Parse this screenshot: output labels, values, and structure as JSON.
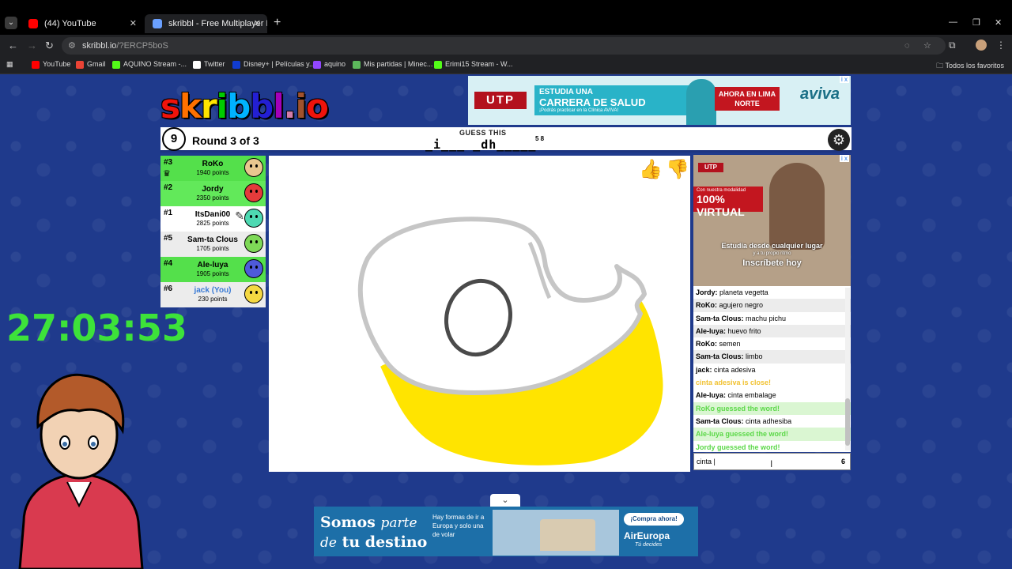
{
  "browser": {
    "tabs": [
      {
        "label": "(44) YouTube",
        "color": "#ff0000"
      },
      {
        "label": "skribbl - Free Multiplayer Drawi",
        "color": "#6aa0ff"
      }
    ],
    "url_host": "skribbl.io",
    "url_path": "/?ERCP5boS",
    "bookmarks": [
      {
        "label": "YouTube",
        "color": "#ff0000"
      },
      {
        "label": "Gmail",
        "color": "#ea4335"
      },
      {
        "label": "AQUINO Stream -...",
        "color": "#53fc18"
      },
      {
        "label": "Twitter",
        "color": "#ffffff"
      },
      {
        "label": "Disney+ | Películas y...",
        "color": "#113ccf"
      },
      {
        "label": "aquino",
        "color": "#9146ff"
      },
      {
        "label": "Mis partidas | Minec...",
        "color": "#5cb85c"
      },
      {
        "label": "Erimi15 Stream - W...",
        "color": "#53fc18"
      }
    ],
    "all_bookmarks": "Todos los favoritos"
  },
  "logo": {
    "letters": [
      "s",
      "k",
      "r",
      "i",
      "b",
      "b",
      "l",
      ".",
      "i",
      "o"
    ],
    "colors": [
      "#ef130b",
      "#ff7100",
      "#ffe400",
      "#00cc00",
      "#00b2ff",
      "#231fd3",
      "#a300ba",
      "#d37caa",
      "#a0522d",
      "#ef130b"
    ]
  },
  "ad_top": {
    "brand": "UTP",
    "line1": "ESTUDIA UNA",
    "line2": "CARRERA DE SALUD",
    "line3": "¡Podrás practicar en la Clínica AVIVA!",
    "cta": "AHORA EN LIMA NORTE",
    "clinic": "aviva",
    "close": "i x"
  },
  "game": {
    "timer": "9",
    "round": "Round 3 of 3",
    "guess_label": "GUESS THIS",
    "word": "_i___ _dh_____",
    "word_lengths": "5 8"
  },
  "players": [
    {
      "rank": "#3",
      "name": "RoKo",
      "points": "1940 points",
      "bg": "green",
      "face": "#e8c78f",
      "crown": "♛"
    },
    {
      "rank": "#2",
      "name": "Jordy",
      "points": "2350 points",
      "bg": "green2",
      "face": "#e33b3b",
      "crown": ""
    },
    {
      "rank": "#1",
      "name": "ItsDani00",
      "points": "2825 points",
      "bg": "white",
      "face": "#4ed9b2",
      "crown": ""
    },
    {
      "rank": "#5",
      "name": "Sam-ta Clous",
      "points": "1705 points",
      "bg": "grey",
      "face": "#7ed957",
      "crown": ""
    },
    {
      "rank": "#4",
      "name": "Ale-luya",
      "points": "1905 points",
      "bg": "green",
      "face": "#4e5ad9",
      "crown": ""
    },
    {
      "rank": "#6",
      "name": "jack (You)",
      "points": "230 points",
      "bg": "grey",
      "face": "#f5d842",
      "crown": ""
    }
  ],
  "ad_side": {
    "brand": "UTP",
    "modality": "Con nuestra modalidad",
    "virtual": "100% VIRTUAL",
    "caption1": "Estudia desde cualquier lugar",
    "caption2": "y a tu propio ritmo",
    "caption3": "Inscríbete hoy"
  },
  "chat": [
    {
      "author": "Jordy:",
      "text": "planeta vegetta",
      "type": "normal"
    },
    {
      "author": "RoKo:",
      "text": "agujero negro",
      "type": "normal"
    },
    {
      "author": "Sam-ta Clous:",
      "text": "machu pichu",
      "type": "normal"
    },
    {
      "author": "Ale-luya:",
      "text": "huevo frito",
      "type": "normal"
    },
    {
      "author": "RoKo:",
      "text": "semen",
      "type": "normal"
    },
    {
      "author": "Sam-ta Clous:",
      "text": "limbo",
      "type": "normal"
    },
    {
      "author": "jack:",
      "text": "cinta adesiva",
      "type": "normal"
    },
    {
      "author": "",
      "text": "cinta adesiva is close!",
      "type": "close"
    },
    {
      "author": "Ale-luya:",
      "text": "cinta embalage",
      "type": "normal"
    },
    {
      "author": "",
      "text": "RoKo guessed the word!",
      "type": "guessed"
    },
    {
      "author": "Sam-ta Clous:",
      "text": "cinta adhesiba",
      "type": "normal"
    },
    {
      "author": "",
      "text": "Ale-luya guessed the word!",
      "type": "guessed"
    },
    {
      "author": "",
      "text": "Jordy guessed the word!",
      "type": "guessed"
    }
  ],
  "chat_input": {
    "value": "cinta |",
    "count": "6"
  },
  "overlay": {
    "stream_timer": "27:03:53"
  },
  "ad_bottom": {
    "somos1": "Somos",
    "parte": "parte",
    "de": "de",
    "destino": "tu destino",
    "hay": "Hay formas de ir a Europa y solo una de volar",
    "compra": "¡Compra ahora!",
    "brand": "AirEuropa",
    "slogan": "Tú decides"
  }
}
